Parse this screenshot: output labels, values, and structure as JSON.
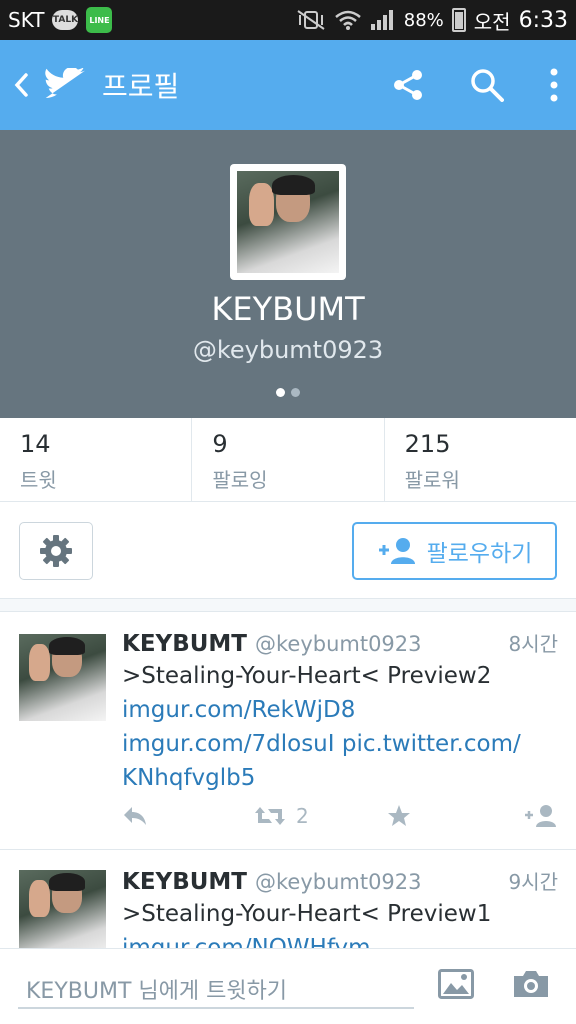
{
  "status_bar": {
    "carrier": "SKT",
    "talk_badge": "TALK",
    "line_badge": "LINE",
    "battery": "88%",
    "ampm": "오전",
    "time": "6:33"
  },
  "app_bar": {
    "title": "프로필"
  },
  "profile": {
    "name": "KEYBUMT",
    "handle": "@keybumt0923",
    "page_dots": 2,
    "active_dot": 0
  },
  "stats": [
    {
      "value": "14",
      "label": "트윗"
    },
    {
      "value": "9",
      "label": "팔로잉"
    },
    {
      "value": "215",
      "label": "팔로워"
    }
  ],
  "actions": {
    "follow_label": "팔로우하기"
  },
  "tweets": [
    {
      "name": "KEYBUMT",
      "handle": "@keybumt0923",
      "time": "8시간",
      "text": ">Stealing-Your-Heart< Preview2",
      "links": [
        "imgur.com/RekWjD8",
        "imgur.com/7dlosuI pic.twitter.com/",
        "KNhqfvglb5"
      ],
      "retweets": "2"
    },
    {
      "name": "KEYBUMT",
      "handle": "@keybumt0923",
      "time": "9시간",
      "text": ">Stealing-Your-Heart< Preview1",
      "links": [
        "imgur.com/NOWHfym"
      ],
      "retweets": ""
    }
  ],
  "composer": {
    "placeholder": "KEYBUMT 님에게 트윗하기"
  },
  "colors": {
    "brand": "#55acee",
    "header_bg": "#66757f",
    "link": "#2b7bb9"
  }
}
